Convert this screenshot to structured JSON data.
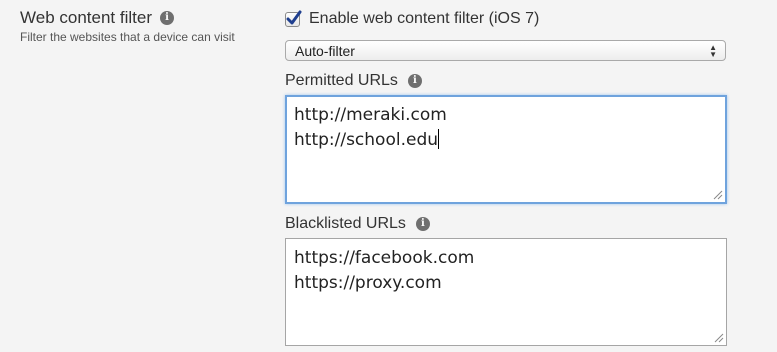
{
  "setting": {
    "title": "Web content filter",
    "description": "Filter the websites that a device can visit"
  },
  "enable_checkbox": {
    "label": "Enable web content filter (iOS 7)",
    "checked": true
  },
  "filter_select": {
    "value": "Auto-filter"
  },
  "permitted": {
    "label": "Permitted URLs",
    "urls": [
      "http://meraki.com",
      "http://school.edu"
    ]
  },
  "blacklisted": {
    "label": "Blacklisted URLs",
    "urls": [
      "https://facebook.com",
      "https://proxy.com"
    ]
  },
  "icons": {
    "info": "info-icon",
    "check": "checkmark-icon",
    "select_arrows": "updown-arrows-icon",
    "resize": "resize-grip-icon"
  },
  "colors": {
    "background": "#f4f4f4",
    "focus_border": "#6fa3dd",
    "check_color": "#1f3f8f"
  }
}
